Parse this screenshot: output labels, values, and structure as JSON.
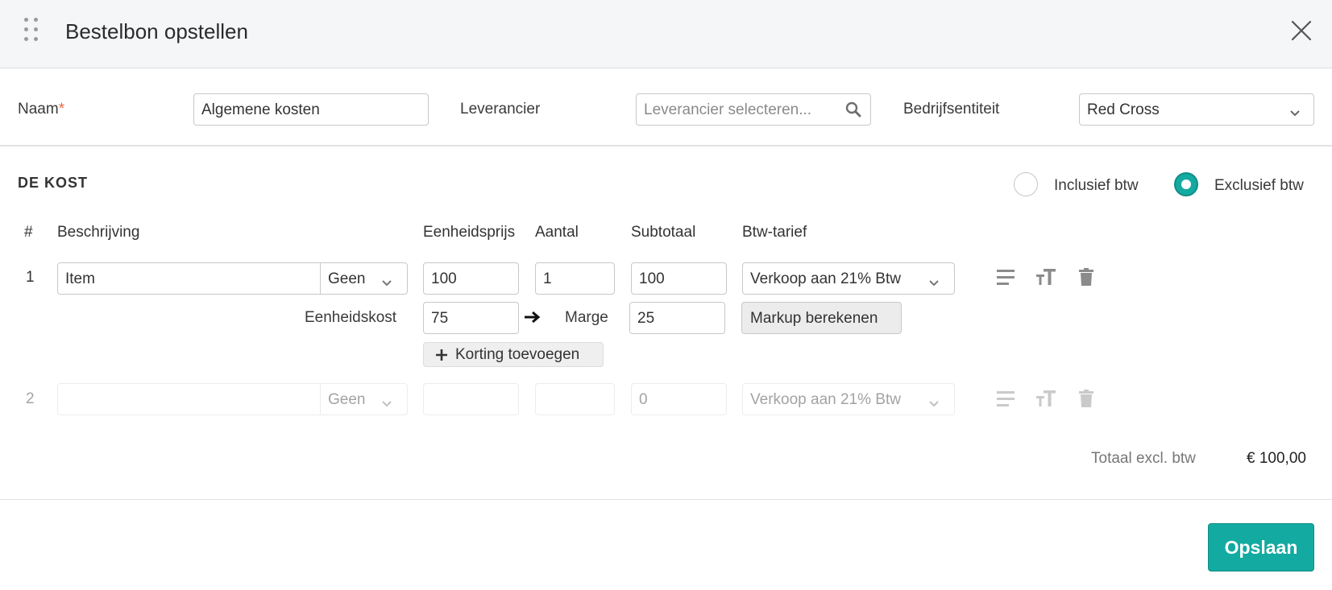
{
  "header": {
    "title": "Bestelbon opstellen"
  },
  "form": {
    "naam_label": "Naam",
    "required_marker": "*",
    "naam_value": "Algemene kosten",
    "leverancier_label": "Leverancier",
    "leverancier_placeholder": "Leverancier selecteren...",
    "entiteit_label": "Bedrijfsentiteit",
    "entiteit_value": "Red Cross"
  },
  "cost": {
    "section_title": "DE KOST",
    "vat_options": [
      {
        "label": "Inclusief btw",
        "selected": false
      },
      {
        "label": "Exclusief btw",
        "selected": true
      }
    ],
    "columns": {
      "num": "#",
      "description": "Beschrijving",
      "unit_price": "Eenheidsprijs",
      "quantity": "Aantal",
      "subtotal": "Subtotaal",
      "vat_rate": "Btw-tarief"
    },
    "lines": [
      {
        "num": "1",
        "description": "Item",
        "category": "Geen",
        "unit_price": "100",
        "quantity": "1",
        "subtotal": "100",
        "vat_rate": "Verkoop aan 21% Btw",
        "unit_cost_label": "Eenheidskost",
        "unit_cost": "75",
        "margin_label": "Marge",
        "margin": "25",
        "markup_button": "Markup berekenen",
        "discount_button": "Korting toevoegen"
      },
      {
        "num": "2",
        "description": "",
        "category": "Geen",
        "unit_price": "",
        "quantity": "",
        "subtotal": "0",
        "vat_rate": "Verkoop aan 21% Btw"
      }
    ],
    "total_label": "Totaal excl. btw",
    "total_value": "€ 100,00"
  },
  "footer": {
    "save_label": "Opslaan"
  },
  "colors": {
    "accent": "#13aaa1",
    "required": "#e8673c",
    "icon": "#8b8b8b"
  }
}
